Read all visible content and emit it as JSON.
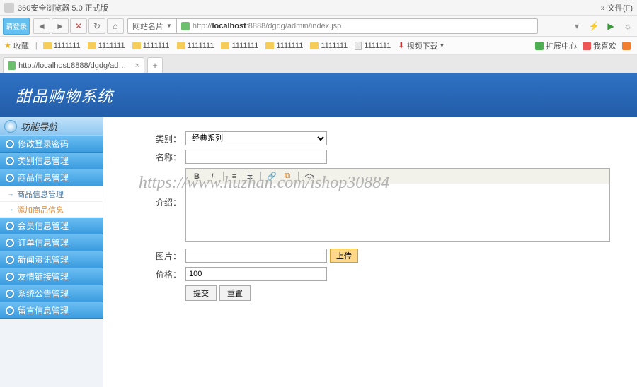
{
  "browser": {
    "title": "360安全浏览器 5.0 正式版",
    "menu_right": "» 文件(F)",
    "login_btn": "请登录",
    "url_prefix": "网站名片",
    "url_display_pre": "http://",
    "url_display_host": "localhost",
    "url_display_rest": ":8888/dgdg/admin/index.jsp",
    "tab_label": "http://localhost:8888/dgdg/admin....",
    "bookmarks_label": "收藏",
    "bookmark_folders": [
      "1111111",
      "1111111",
      "1111111",
      "1111111",
      "1111111",
      "1111111",
      "1111111"
    ],
    "bookmark_page": "1111111",
    "bookmark_video": "视频下载",
    "ext_center": "扩展中心",
    "ext_like": "我喜欢"
  },
  "app": {
    "banner_title": "甜品购物系统",
    "sidebar_header": "功能导航",
    "side_items": {
      "pwd": "修改登录密码",
      "cat": "类别信息管理",
      "goods": "商品信息管理",
      "goods_sub_manage": "商品信息管理",
      "goods_sub_add": "添加商品信息",
      "member": "会员信息管理",
      "order": "订单信息管理",
      "news": "新闻资讯管理",
      "link": "友情链接管理",
      "notice": "系统公告管理",
      "msg": "留言信息管理"
    },
    "form": {
      "label_category": "类别：",
      "category_value": "经典系列",
      "label_name": "名称：",
      "name_value": "",
      "label_intro": "介绍：",
      "label_image": "图片：",
      "image_value": "",
      "btn_upload": "上传",
      "label_price": "价格：",
      "price_value": "100",
      "btn_submit": "提交",
      "btn_reset": "重置"
    },
    "watermark": "https://www.huzhan.com/ishop30884"
  }
}
